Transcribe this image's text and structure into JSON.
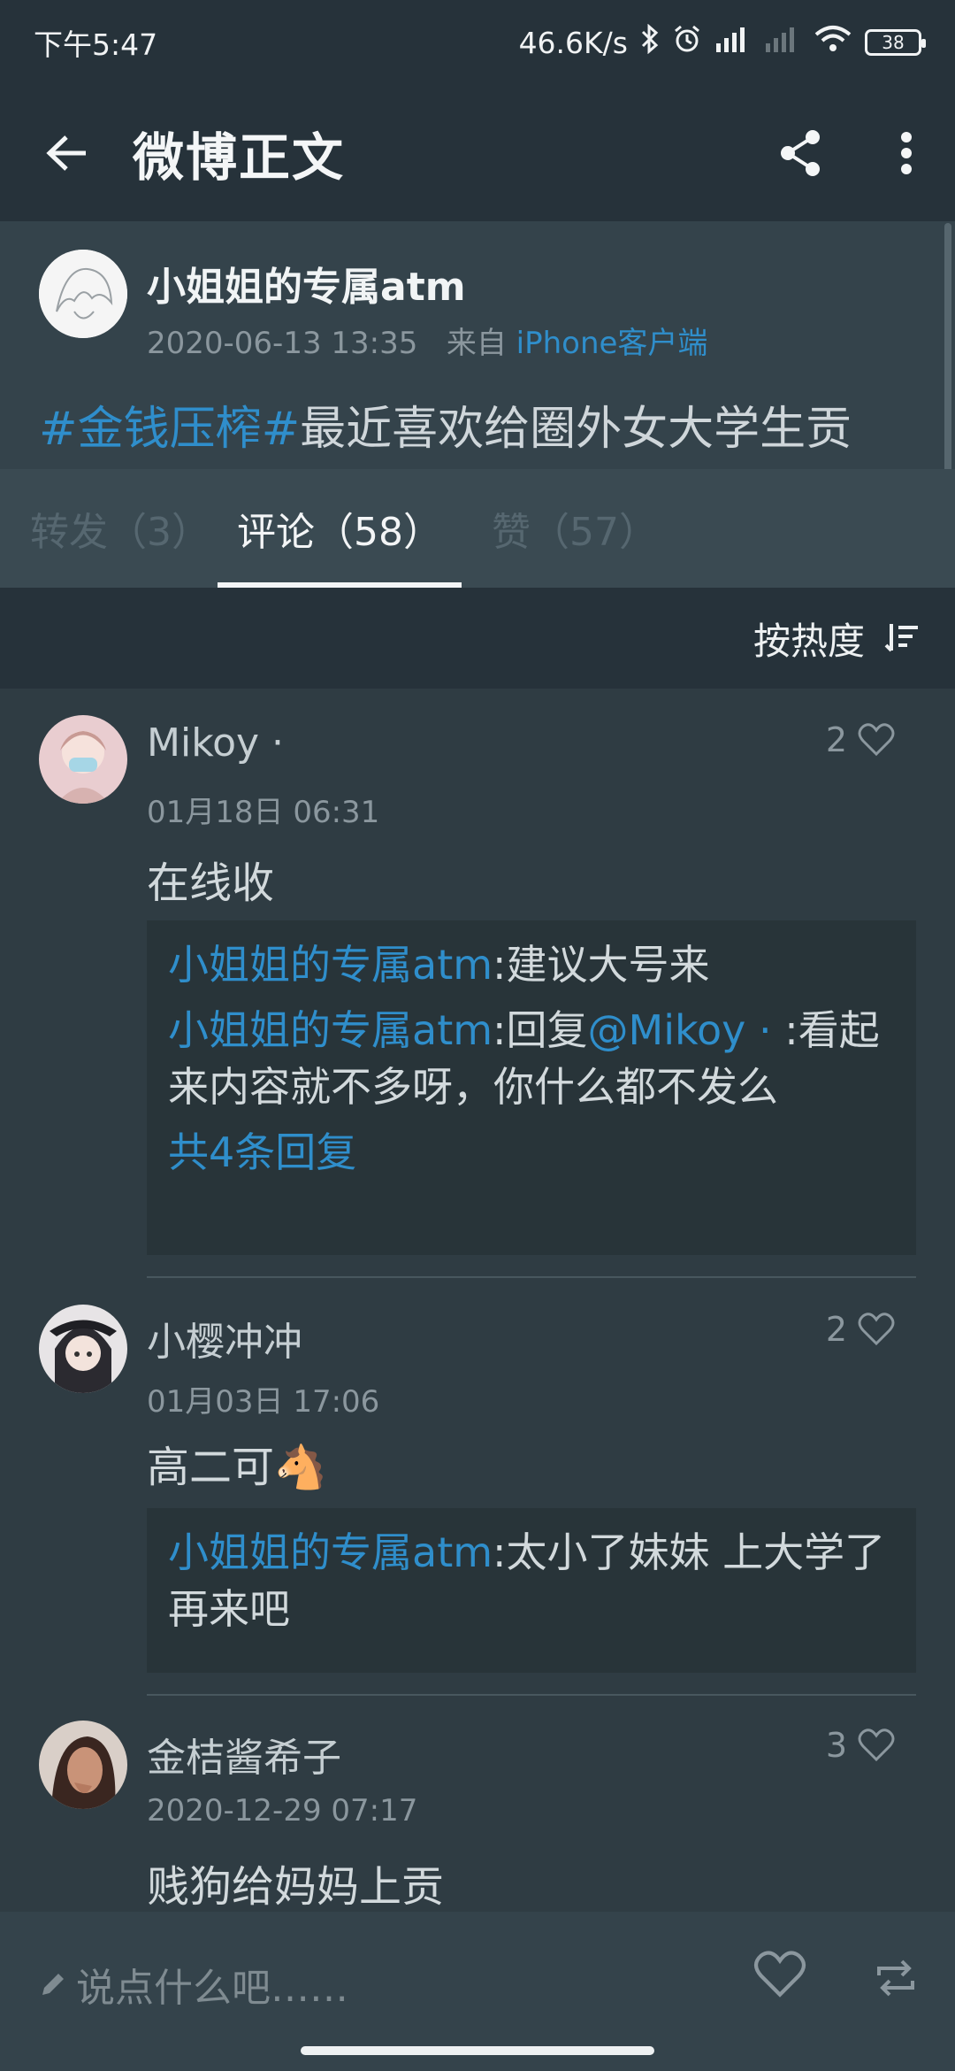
{
  "status_bar": {
    "time": "下午5:47",
    "net_speed": "46.6K/s",
    "battery": "38"
  },
  "app_bar": {
    "title": "微博正文",
    "icons": [
      "back-arrow-icon",
      "share-icon",
      "more-vert-icon"
    ]
  },
  "post": {
    "author": "小姐姐的专属atm",
    "time": "2020-06-13 13:35",
    "from_label": "来自",
    "source": "iPhone客户端",
    "tag": "#金钱压榨#",
    "text": "最近喜欢给圈外女大学生贡"
  },
  "tabs": [
    {
      "label": "转发（3）"
    },
    {
      "label": "评论（58）"
    },
    {
      "label": "赞（57）"
    }
  ],
  "sort": {
    "label": "按热度"
  },
  "comments": [
    {
      "name": "Mikoy ·",
      "date": "01月18日 06:31",
      "likes": "2",
      "text": "在线收",
      "replies": [
        {
          "who": "小姐姐的专属atm",
          "text": ":建议大号来"
        },
        {
          "who": "小姐姐的专属atm",
          "text": ":回复",
          "mention": "@Mikoy ·",
          "text2": " :看起来内容就不多呀，你什么都不发么"
        }
      ],
      "more": "共4条回复"
    },
    {
      "name": "小樱冲冲",
      "date": "01月03日 17:06",
      "likes": "2",
      "text": "高二可🐴",
      "replies": [
        {
          "who": "小姐姐的专属atm",
          "text": ":太小了妹妹 上大学了再来吧"
        }
      ]
    },
    {
      "name": "金桔酱希子",
      "date": "2020-12-29 07:17",
      "likes": "3",
      "text": "贱狗给妈妈上贡"
    }
  ],
  "input": {
    "placeholder": "说点什么吧……"
  },
  "colors": {
    "accent": "#2f8ecb",
    "background": "#2f3c43",
    "appbar": "#26323a"
  }
}
